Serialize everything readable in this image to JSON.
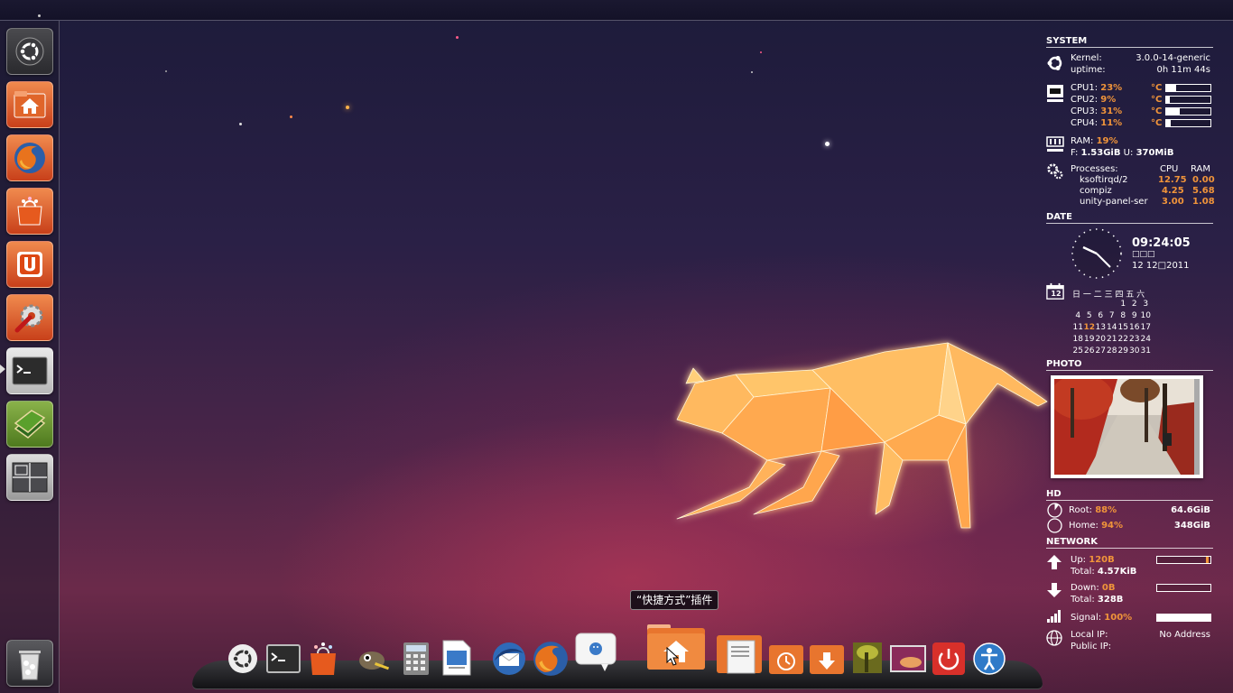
{
  "launcher": {
    "items": [
      {
        "name": "dash-home",
        "icon": "ubuntu-logo-icon"
      },
      {
        "name": "home-folder",
        "icon": "home-folder-icon"
      },
      {
        "name": "firefox",
        "icon": "firefox-icon"
      },
      {
        "name": "software-center",
        "icon": "shopping-bag-icon"
      },
      {
        "name": "ubuntu-one",
        "icon": "ubuntu-one-icon"
      },
      {
        "name": "system-settings",
        "icon": "wrench-gear-icon"
      },
      {
        "name": "terminal",
        "icon": "terminal-icon"
      },
      {
        "name": "dictionary",
        "icon": "books-icon"
      },
      {
        "name": "workspace-switcher",
        "icon": "workspaces-icon"
      }
    ],
    "trash": {
      "icon": "trash-icon"
    }
  },
  "conky": {
    "system": {
      "header": "SYSTEM",
      "kernel_label": "Kernel:",
      "kernel_value": "3.0.0-14-generic",
      "uptime_label": "uptime:",
      "uptime_value": "0h 11m 44s",
      "cpus": [
        {
          "label": "CPU1:",
          "value": "23%",
          "temp": "°C",
          "graph_level": 0.23
        },
        {
          "label": "CPU2:",
          "value": "9%",
          "temp": "°C",
          "graph_level": 0.09
        },
        {
          "label": "CPU3:",
          "value": "31%",
          "temp": "°C",
          "graph_level": 0.31
        },
        {
          "label": "CPU4:",
          "value": "11%",
          "temp": "°C",
          "graph_level": 0.11
        }
      ],
      "ram_label": "RAM:",
      "ram_value": "19%",
      "free_label": "F:",
      "free_value": "1.53GiB",
      "used_label": "U:",
      "used_value": "370MiB",
      "processes_label": "Processes:",
      "cpu_col": "CPU",
      "ram_col": "RAM",
      "processes": [
        {
          "name": "ksoftirqd/2",
          "cpu": "12.75",
          "ram": "0.00"
        },
        {
          "name": "compiz",
          "cpu": "4.25",
          "ram": "5.68"
        },
        {
          "name": "unity-panel-ser",
          "cpu": "3.00",
          "ram": "1.08"
        }
      ]
    },
    "date": {
      "header": "DATE",
      "time": "09:24:05",
      "weekday": "□□□",
      "date": "12 12□2011",
      "calendar_icon_day": "12",
      "weekdays": "日 一 二 三 四 五 六",
      "weeks": [
        [
          "",
          "",
          "",
          "",
          "1",
          "2",
          "3"
        ],
        [
          "4",
          "5",
          "6",
          "7",
          "8",
          "9",
          "10"
        ],
        [
          "11",
          "12",
          "13",
          "14",
          "15",
          "16",
          "17"
        ],
        [
          "18",
          "19",
          "20",
          "21",
          "22",
          "23",
          "24"
        ],
        [
          "25",
          "26",
          "27",
          "28",
          "29",
          "30",
          "31"
        ]
      ],
      "today": "12"
    },
    "photo": {
      "header": "PHOTO"
    },
    "hd": {
      "header": "HD",
      "root_label": "Root:",
      "root_value": "88%",
      "root_size": "64.6GiB",
      "home_label": "Home:",
      "home_value": "94%",
      "home_size": "348GiB"
    },
    "network": {
      "header": "NETWORK",
      "up_label": "Up:",
      "up_value": "120B",
      "up_total_label": "Total:",
      "up_total": "4.57KiB",
      "down_label": "Down:",
      "down_value": "0B",
      "down_total_label": "Total:",
      "down_total": "328B",
      "signal_label": "Signal:",
      "signal_value": "100%",
      "signal_level": 1.0,
      "local_ip_label": "Local IP:",
      "public_ip_label": "Public IP:",
      "ip_value": "No Address"
    }
  },
  "tooltip": "“快捷方式”插件",
  "dock": {
    "items": [
      {
        "name": "ubuntu-logo",
        "icon": "ubuntu-logo-icon"
      },
      {
        "name": "terminal",
        "icon": "terminal-icon"
      },
      {
        "name": "software-center",
        "icon": "shopping-bag-icon"
      },
      {
        "name": "gimp",
        "icon": "gimp-icon"
      },
      {
        "name": "calculator",
        "icon": "calculator-icon"
      },
      {
        "name": "impress",
        "icon": "presentation-icon"
      },
      {
        "name": "thunderbird",
        "icon": "thunderbird-icon"
      },
      {
        "name": "firefox",
        "icon": "firefox-icon"
      },
      {
        "name": "empathy",
        "icon": "chat-bubble-icon"
      },
      {
        "name": "home-folder",
        "icon": "home-folder-icon"
      },
      {
        "name": "documents",
        "icon": "documents-folder-icon"
      },
      {
        "name": "backup",
        "icon": "backup-folder-icon"
      },
      {
        "name": "downloads",
        "icon": "downloads-folder-icon"
      },
      {
        "name": "pictures",
        "icon": "pictures-icon"
      },
      {
        "name": "wallpaper",
        "icon": "wallpaper-icon"
      },
      {
        "name": "shutdown",
        "icon": "power-icon"
      },
      {
        "name": "accessibility",
        "icon": "accessibility-icon"
      }
    ]
  },
  "colors": {
    "accent": "#f0943a",
    "ubuntu_orange": "#dd4814",
    "launcher_bg": "#2a2438"
  }
}
